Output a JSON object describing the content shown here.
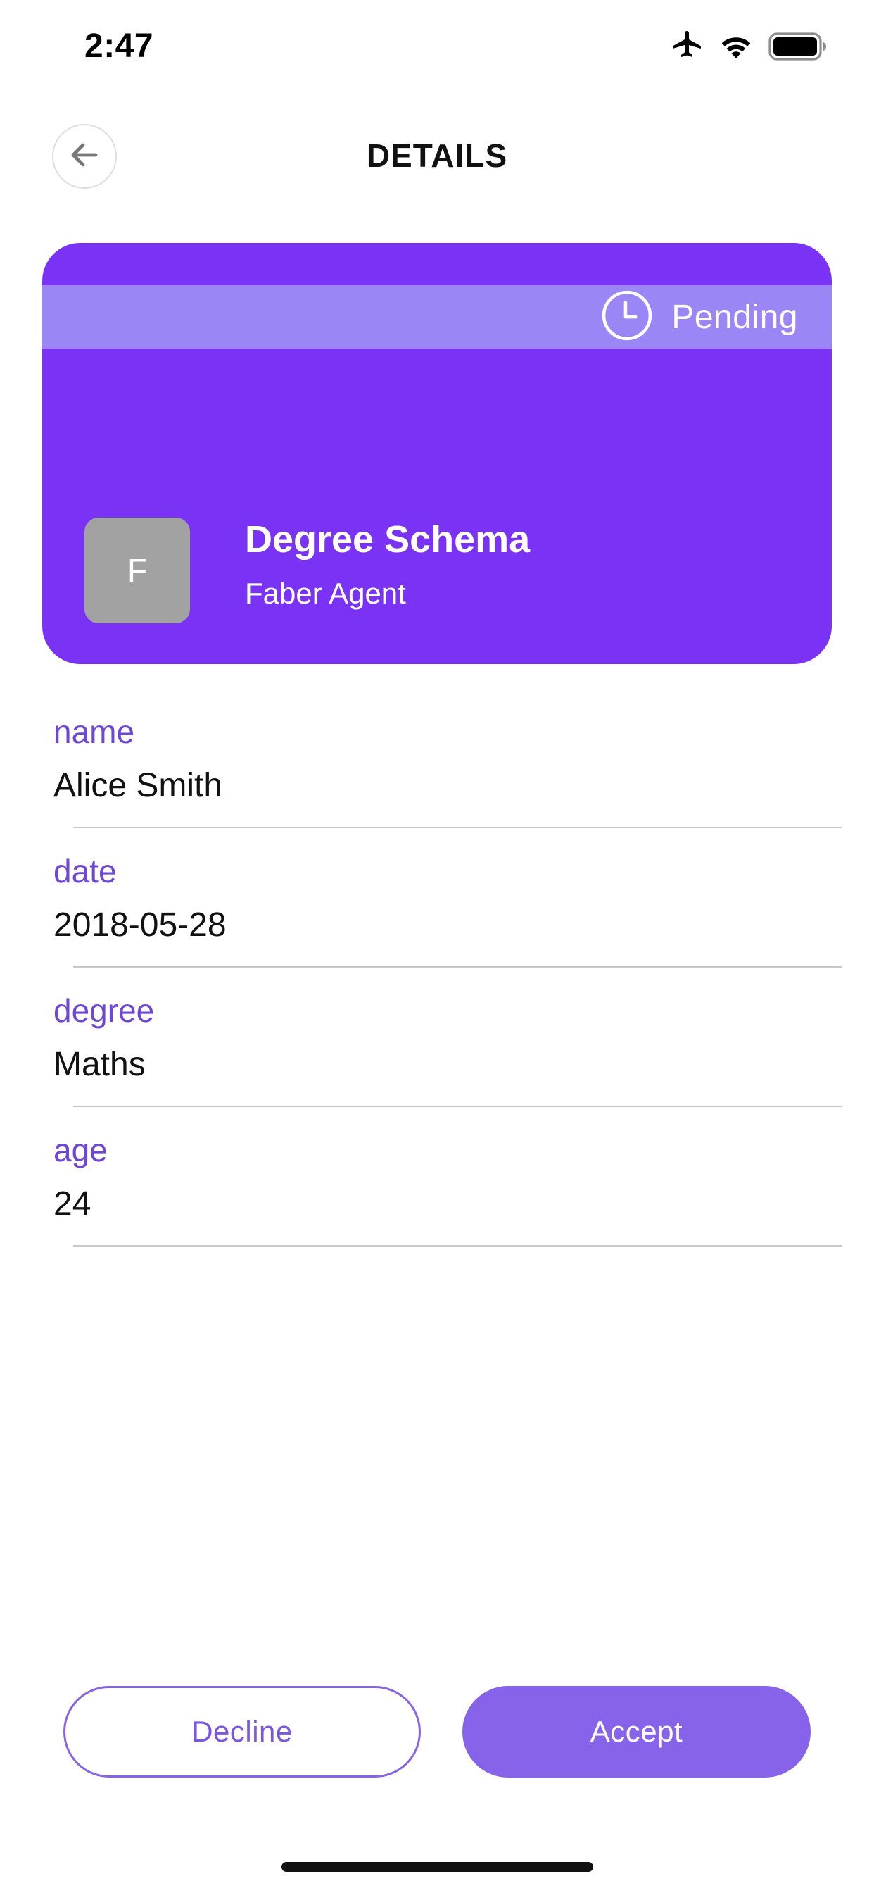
{
  "status_bar": {
    "time": "2:47",
    "icons": [
      "airplane-icon",
      "wifi-icon",
      "battery-icon"
    ]
  },
  "header": {
    "title": "DETAILS",
    "back_icon": "arrow-left-icon"
  },
  "card": {
    "status_icon": "clock-icon",
    "status_label": "Pending",
    "avatar_initial": "F",
    "title": "Degree Schema",
    "subtitle": "Faber Agent"
  },
  "attributes": [
    {
      "label": "name",
      "value": "Alice Smith"
    },
    {
      "label": "date",
      "value": "2018-05-28"
    },
    {
      "label": "degree",
      "value": "Maths"
    },
    {
      "label": "age",
      "value": "24"
    }
  ],
  "actions": {
    "decline_label": "Decline",
    "accept_label": "Accept"
  },
  "colors": {
    "card_background": "#7a32f5",
    "status_strip": "#9a87f5",
    "accent": "#7b56e0",
    "accept_button": "#8663e8",
    "avatar": "#a2a2a2"
  }
}
